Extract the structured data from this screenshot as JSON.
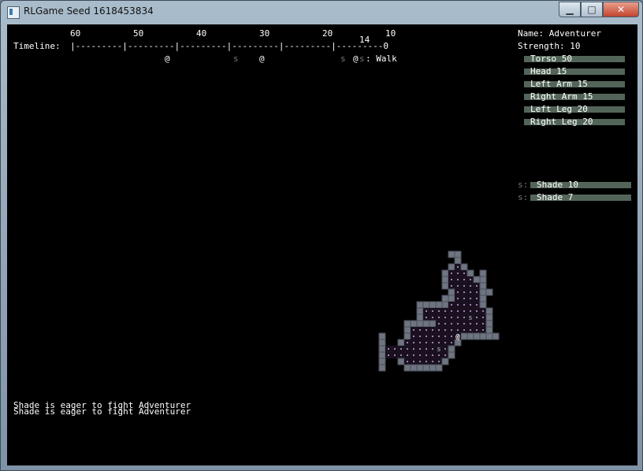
{
  "window": {
    "title": "RLGame Seed 1618453834",
    "min_glyph": "▁",
    "max_glyph": "□",
    "close_glyph": "✕"
  },
  "timeline": {
    "label": "Timeline:",
    "ticks": [
      "60",
      "50",
      "40",
      "30",
      "20",
      "10"
    ],
    "rule": "|---------|---------|---------|---------|---------|---------0",
    "current": "14",
    "tokens": [
      {
        "glyph": "@",
        "kind": "player"
      },
      {
        "glyph": "s",
        "kind": "monster"
      },
      {
        "glyph": "@",
        "kind": "player"
      },
      {
        "glyph": "s",
        "kind": "monster"
      },
      {
        "glyph": "@",
        "kind": "player"
      },
      {
        "glyph": "s",
        "kind": "monster"
      }
    ],
    "action_text": ": Walk"
  },
  "player": {
    "name_label": "Name: Adventurer",
    "strength_label": "Strength: 10",
    "body_parts": [
      {
        "label": "Torso 50",
        "hp": 50
      },
      {
        "label": "Head 15",
        "hp": 15
      },
      {
        "label": "Left Arm 15",
        "hp": 15
      },
      {
        "label": "Right Arm 15",
        "hp": 15
      },
      {
        "label": "Left Leg 20",
        "hp": 20
      },
      {
        "label": "Right Leg 20",
        "hp": 20
      }
    ]
  },
  "enemies": [
    {
      "glyph": "s:",
      "label": "Shade 10",
      "hp": 10
    },
    {
      "glyph": "s:",
      "label": "Shade 7",
      "hp": 7
    }
  ],
  "log": [
    "Shade is eager to fight Adventurer",
    "Shade is eager to fight Adventurer"
  ],
  "colors": {
    "bar": "#536559",
    "wall": "#6e7480",
    "floor": "#1a1020",
    "floor_dot": "#9a86a8",
    "monster": "#888888",
    "player": "#ffffff"
  }
}
